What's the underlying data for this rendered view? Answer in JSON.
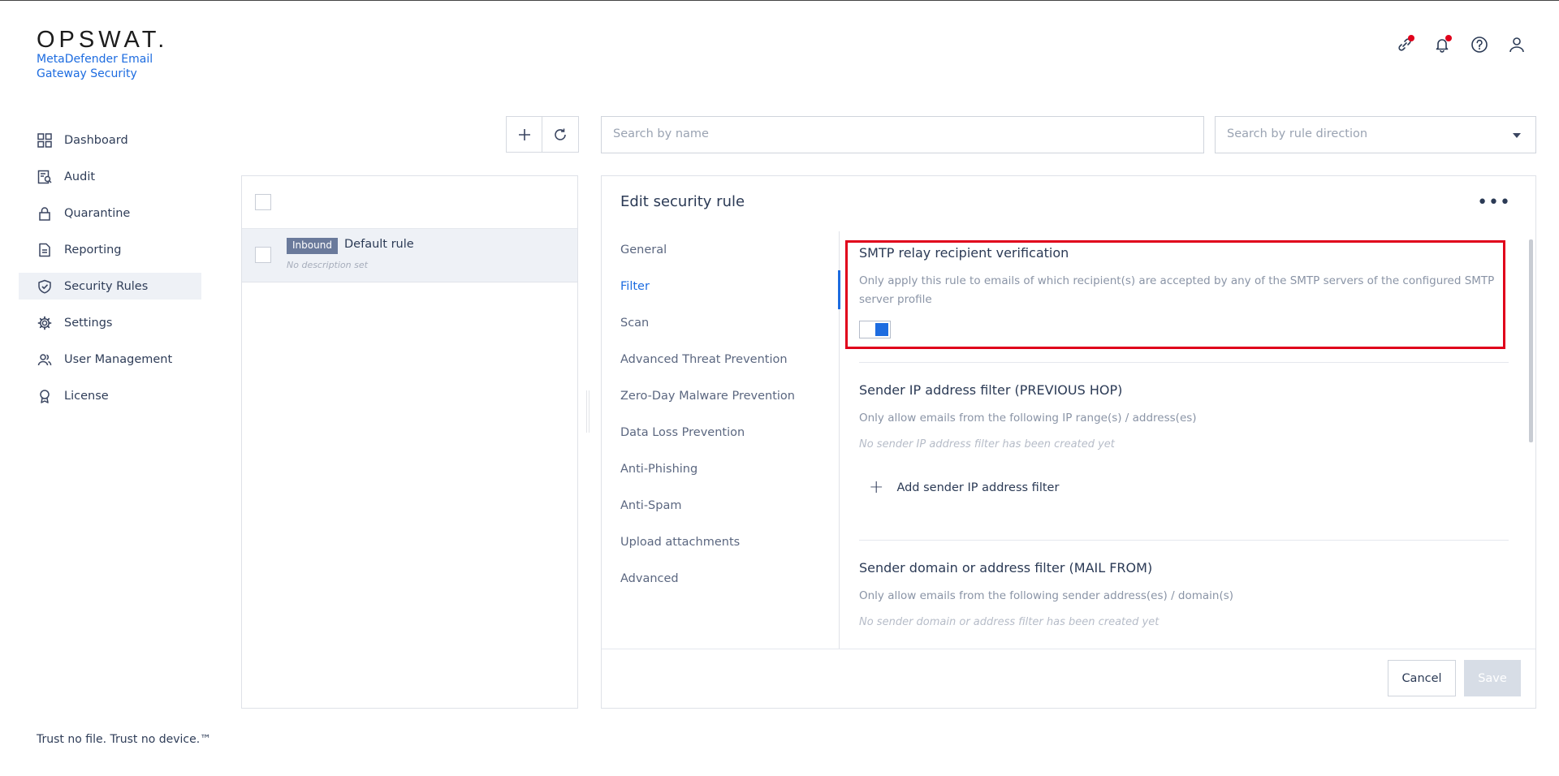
{
  "brand": {
    "logo": "OPSWAT.",
    "product": "MetaDefender Email Gateway Security",
    "tagline": "Trust no file. Trust no device.™"
  },
  "nav": {
    "items": [
      {
        "label": "Dashboard",
        "icon": "grid-icon"
      },
      {
        "label": "Audit",
        "icon": "audit-icon"
      },
      {
        "label": "Quarantine",
        "icon": "lock-icon"
      },
      {
        "label": "Reporting",
        "icon": "document-icon"
      },
      {
        "label": "Security Rules",
        "icon": "shield-check-icon"
      },
      {
        "label": "Settings",
        "icon": "gear-icon"
      },
      {
        "label": "User Management",
        "icon": "users-icon"
      },
      {
        "label": "License",
        "icon": "award-icon"
      }
    ],
    "active": "Security Rules"
  },
  "search": {
    "name_placeholder": "Search by name",
    "direction_placeholder": "Search by rule direction"
  },
  "rules": [
    {
      "direction": "Inbound",
      "name": "Default rule",
      "description": "No description set"
    }
  ],
  "editor": {
    "title": "Edit security rule",
    "tabs": [
      "General",
      "Filter",
      "Scan",
      "Advanced Threat Prevention",
      "Zero-Day Malware Prevention",
      "Data Loss Prevention",
      "Anti-Phishing",
      "Anti-Spam",
      "Upload attachments",
      "Advanced"
    ],
    "active_tab": "Filter",
    "sections": {
      "smtp": {
        "title": "SMTP relay recipient verification",
        "description": "Only apply this rule to emails of which recipient(s) are accepted by any of the SMTP servers of the configured SMTP server profile",
        "enabled": true
      },
      "sender_ip": {
        "title": "Sender IP address filter (PREVIOUS HOP)",
        "description": "Only allow emails from the following IP range(s) / address(es)",
        "empty": "No sender IP address filter has been created yet",
        "add_label": "Add sender IP address filter"
      },
      "sender_domain": {
        "title": "Sender domain or address filter (MAIL FROM)",
        "description": "Only allow emails from the following sender address(es) / domain(s)",
        "empty": "No sender domain or address filter has been created yet"
      }
    },
    "cancel_label": "Cancel",
    "save_label": "Save"
  },
  "colors": {
    "accent": "#1d6ce0",
    "highlight": "#e0001b",
    "badge": "#6a7a9b"
  }
}
